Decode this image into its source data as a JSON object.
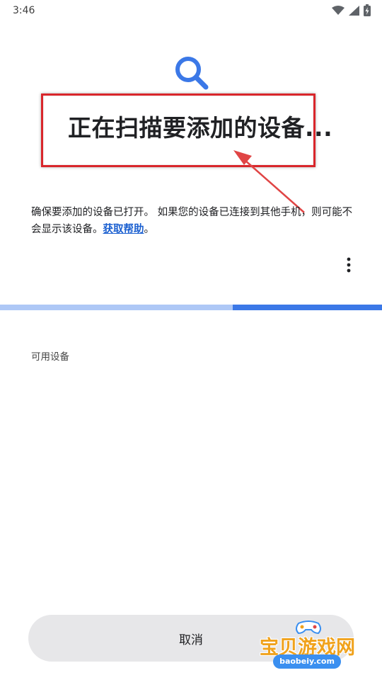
{
  "status_bar": {
    "time": "3:46",
    "icons": [
      "wifi-icon",
      "signal-icon",
      "battery-charging-icon"
    ]
  },
  "header": {
    "icon": "search-icon",
    "title": "正在扫描要添加的设备..."
  },
  "description": {
    "text": "确保要添加的设备已打开。 如果您的设备已连接到其他手机，则可能不会显示该设备。",
    "help_link": "获取帮助",
    "suffix": "。"
  },
  "progress": {
    "value": 0.39
  },
  "available_devices": {
    "label": "可用设备",
    "items": []
  },
  "footer": {
    "cancel_label": "取消"
  },
  "watermark": {
    "brand": "宝贝游戏网",
    "url": "baobeiy.com"
  },
  "colors": {
    "accent": "#3b78e7",
    "progress_track": "#aec8f6",
    "link": "#1a5fd0",
    "annotation": "#d9262b",
    "button_bg": "#e7e7e9"
  }
}
